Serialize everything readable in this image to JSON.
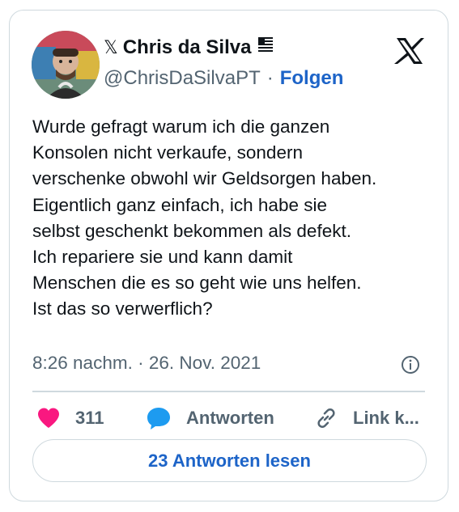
{
  "author": {
    "display_name": "Chris da Silva",
    "handle": "@ChrisDaSilvaPT",
    "separator": "·",
    "follow_label": "Folgen"
  },
  "tweet": {
    "lines": [
      "Wurde gefragt warum ich die ganzen",
      "Konsolen nicht verkaufe, sondern",
      "verschenke obwohl wir Geldsorgen haben.",
      "Eigentlich ganz einfach, ich habe sie",
      "selbst geschenkt bekommen als defekt.",
      "Ich repariere sie und kann damit",
      "Menschen die es so geht wie uns helfen.",
      "Ist das so verwerflich?"
    ],
    "timestamp": "8:26 nachm. · 26. Nov. 2021"
  },
  "actions": {
    "like_count": "311",
    "reply_label": "Antworten",
    "link_label": "Link k..."
  },
  "read_replies_label": "23 Antworten lesen",
  "colors": {
    "like": "#f91880",
    "reply": "#1d9bf0",
    "link_blue": "#1d64c8",
    "secondary_text": "#536471",
    "border": "#cfd9de"
  },
  "icons": [
    "x-logo-icon",
    "striped-flag-icon",
    "heart-icon",
    "reply-bubble-icon",
    "link-icon",
    "info-icon"
  ]
}
